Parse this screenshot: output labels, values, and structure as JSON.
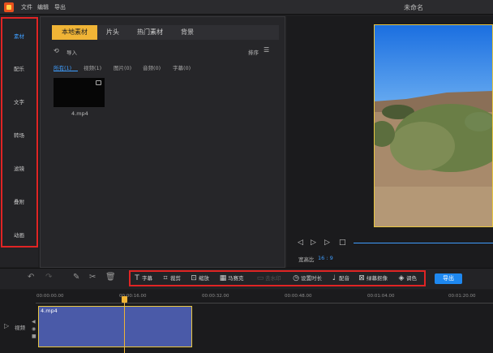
{
  "menu": [
    "文件",
    "编辑",
    "导出"
  ],
  "document_title": "未命名",
  "sidebar": {
    "items": [
      {
        "label": "素材",
        "active": true
      },
      {
        "label": "配乐"
      },
      {
        "label": "文字"
      },
      {
        "label": "转场"
      },
      {
        "label": "滤镜"
      },
      {
        "label": "叠附"
      },
      {
        "label": "动画"
      }
    ]
  },
  "media": {
    "tabs": [
      {
        "label": "本地素材",
        "active": true
      },
      {
        "label": "片头"
      },
      {
        "label": "热门素材"
      },
      {
        "label": "背景"
      }
    ],
    "import_label": "导入",
    "sort_label": "排序",
    "filters": [
      {
        "label": "所有(1)",
        "active": true
      },
      {
        "label": "视频(1)"
      },
      {
        "label": "图片(0)"
      },
      {
        "label": "音频(0)"
      },
      {
        "label": "字幕(0)"
      }
    ],
    "files": [
      {
        "name": "4.mp4"
      }
    ]
  },
  "preview": {
    "aspect_label": "宽高比",
    "aspect_value": "16 : 9"
  },
  "toolbar": {
    "tools": [
      {
        "label": "字幕",
        "icon": "text-icon"
      },
      {
        "label": "裁剪",
        "icon": "crop-icon"
      },
      {
        "label": "缩放",
        "icon": "zoom-icon"
      },
      {
        "label": "马赛克",
        "icon": "mosaic-icon"
      },
      {
        "label": "去水印",
        "icon": "watermark-icon",
        "disabled": true
      },
      {
        "label": "设置时长",
        "icon": "clock-icon"
      },
      {
        "label": "配音",
        "icon": "mic-icon"
      },
      {
        "label": "绿幕抠像",
        "icon": "greenscreen-icon"
      },
      {
        "label": "调色",
        "icon": "palette-icon"
      }
    ],
    "export_label": "导出"
  },
  "timeline": {
    "ticks": [
      "00:00:00.00",
      "00:00:16.00",
      "00:00:32.00",
      "00:00:48.00",
      "00:01:04.00",
      "00:01:20.00"
    ],
    "track_label": "视频",
    "clip_name": "4.mp4"
  },
  "colors": {
    "accent": "#3f9eff",
    "tab_active": "#f0b436",
    "highlight_box": "#e02424",
    "clip_fill": "#4a5aa8"
  }
}
